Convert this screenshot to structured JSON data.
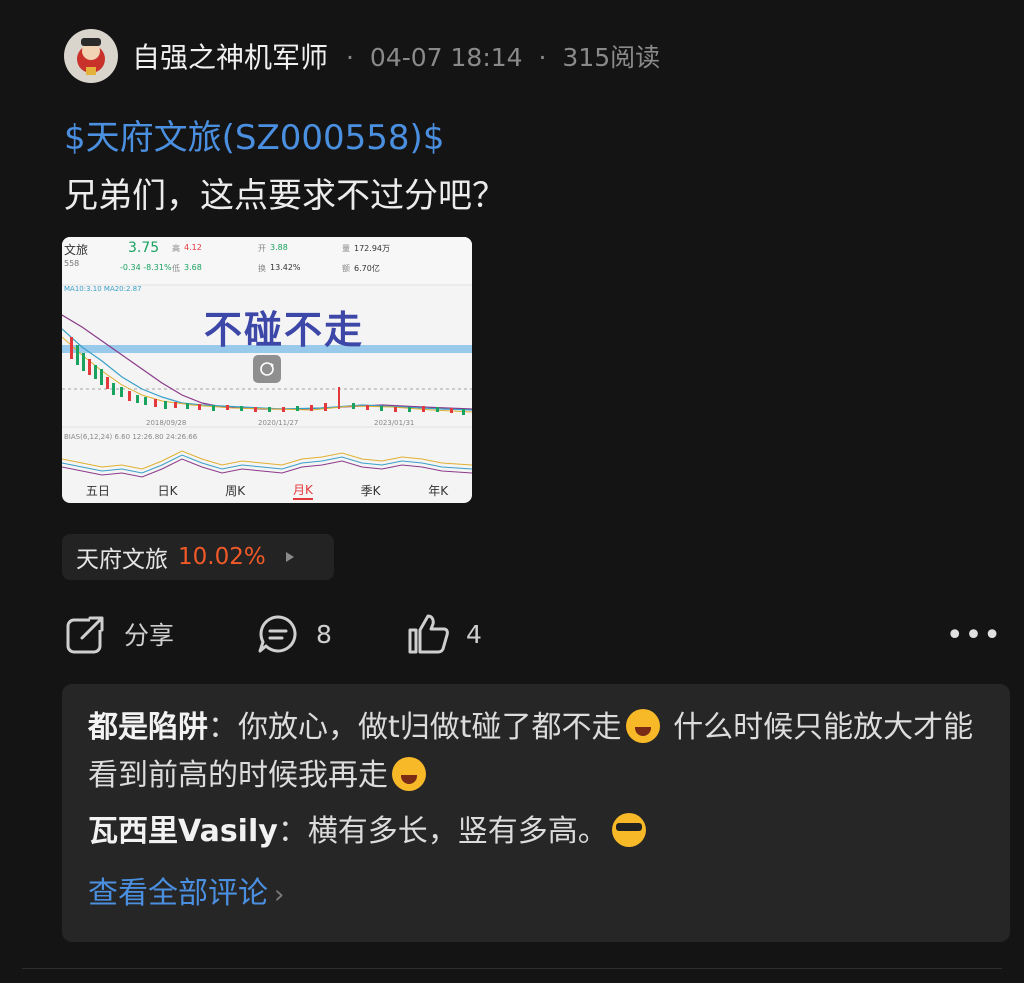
{
  "header": {
    "author": "自强之神机军师",
    "date": "04-07 18:14",
    "reads": "315阅读",
    "sep": "·"
  },
  "post": {
    "stock_link": "$天府文旅(SZ000558)$",
    "text": "兄弟们，这点要求不过分吧？"
  },
  "thumbnail": {
    "name": "文旅",
    "code": "558",
    "price": "3.75",
    "change": "-0.34 -8.31%",
    "high_label": "高",
    "high": "4.12",
    "low_label": "低",
    "low": "3.68",
    "open_label": "开",
    "open": "3.88",
    "turnover_label": "换",
    "turnover": "13.42%",
    "volume_label": "量",
    "volume": "172.94万",
    "amount_label": "额",
    "amount": "6.70亿",
    "ma_line": "MA10:3.10  MA20:2.87",
    "overlay_text": "不碰不走",
    "dates": [
      "2018/09/28",
      "2020/11/27",
      "2023/01/31"
    ],
    "bias_line": "BIAS(6,12,24)  6.60  12:26.80  24:26.66",
    "tabs": [
      "五日",
      "日K",
      "周K",
      "月K",
      "季K",
      "年K"
    ],
    "active_tab": "月K",
    "colors": {
      "up": "#e4393c",
      "down": "#1aa260",
      "overlay": "#3c47a8"
    }
  },
  "chip": {
    "name": "天府文旅",
    "change": "10.02%",
    "change_color": "#f05a28"
  },
  "actions": {
    "share": "分享",
    "comments": "8",
    "likes": "4",
    "more": "•••"
  },
  "comments": [
    {
      "user": "都是陷阱",
      "sep": "：",
      "text_a": "你放心，做t归做t碰了都不走",
      "text_b": " 什么时候只能放大才能看到前高的时候我再走",
      "emoji": "laugh"
    },
    {
      "user": "瓦西里Vasily",
      "sep": "：",
      "text_a": "横有多长，竖有多高。",
      "emoji": "cool"
    }
  ],
  "view_all": "查看全部评论"
}
